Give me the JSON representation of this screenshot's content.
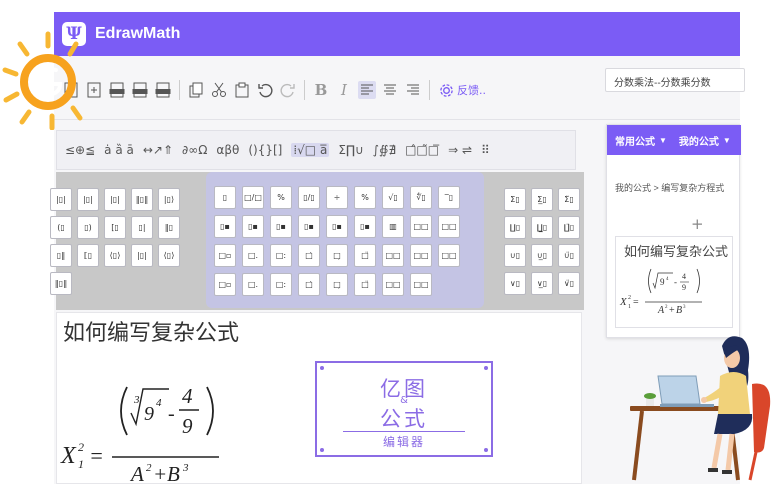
{
  "app": {
    "name": "EdrawMath",
    "logo_glyph": "Ψ",
    "accent": "#7b5cf5"
  },
  "toolbar": {
    "feedback_label": "反馈..",
    "bold_label": "B",
    "italic_label": "I",
    "search_value": "分数乘法--分数乘分数",
    "icons": [
      "new-file-icon",
      "new-template-icon",
      "export-png-icon",
      "export-svg-icon",
      "export-pdf-icon",
      "copy-icon",
      "cut-icon",
      "paste-icon",
      "undo-icon",
      "redo-icon",
      "bold-icon",
      "italic-icon",
      "align-left-icon",
      "align-center-icon",
      "align-right-icon",
      "settings-icon"
    ]
  },
  "symbol_groups": [
    "≤⊕≦",
    "ȧ ȁ ā",
    "↔↗⇑",
    "∂∞Ω",
    "αβθ",
    "(){}[]",
    "⁞√□ a̅",
    "Σ∏∪",
    "∫∯∄",
    "□̂□̃□̅",
    "⇒ ⇌",
    "⠿"
  ],
  "templates": {
    "left_cells": [
      "|▯|",
      "|▯|",
      "|▯|",
      "‖▯‖",
      "|▯⟩",
      "(▯",
      "▯)",
      "[▯",
      "▯|",
      "‖▯",
      "▯‖",
      "⟦▯",
      "⟨▯⟩",
      "|▯|",
      "⟨▯⟩",
      "‖▯‖"
    ],
    "mid_cells": [
      "▯",
      "□/□",
      "%",
      "▯/▯",
      "÷",
      "%",
      "√▯",
      "∜▯",
      "‾▯",
      "▯▪",
      "▯▪",
      "▯▪",
      "▯▪",
      "▯▪",
      "▯▪",
      "▥",
      "□□",
      "□□",
      "□▫",
      "□.",
      "□:",
      "□̇",
      "□̣",
      "□̈",
      "□□",
      "□□",
      "□□",
      "□▫",
      "□.",
      "□:",
      "□̇",
      "□̣",
      "□̈",
      "□□",
      "□□"
    ],
    "right_cells": [
      "Σ▯",
      "Σ̲▯",
      "Σ̈▯",
      "∐▯",
      "∐̲▯",
      "∐̈▯",
      "∪▯",
      "∪̲▯",
      "∪̈▯",
      "∨▯",
      "∨̲▯",
      "∨̈▯"
    ]
  },
  "right_panel": {
    "tabs": [
      "常用公式",
      "我的公式"
    ],
    "breadcrumb": "我的公式 > 编写复杂方程式",
    "actions": "+ ···",
    "thumb_title": "如何编写复杂公式"
  },
  "document": {
    "title": "如何编写复杂公式",
    "formula": {
      "lhs_var": "X",
      "lhs_sup": "2",
      "lhs_sub": "1",
      "equals": "=",
      "root_index": "3",
      "radicand": "9",
      "radicand_sup": "4",
      "minus": "-",
      "frac_num": "4",
      "frac_den": "9",
      "den_a": "A",
      "den_a_sup": "2",
      "plus": "+",
      "den_b": "B",
      "den_b_sup": "3"
    }
  },
  "stamp": {
    "line1": "亿图",
    "amp": "&",
    "line2": "公式",
    "line3": "编辑器",
    "color": "#8b6ce5"
  }
}
